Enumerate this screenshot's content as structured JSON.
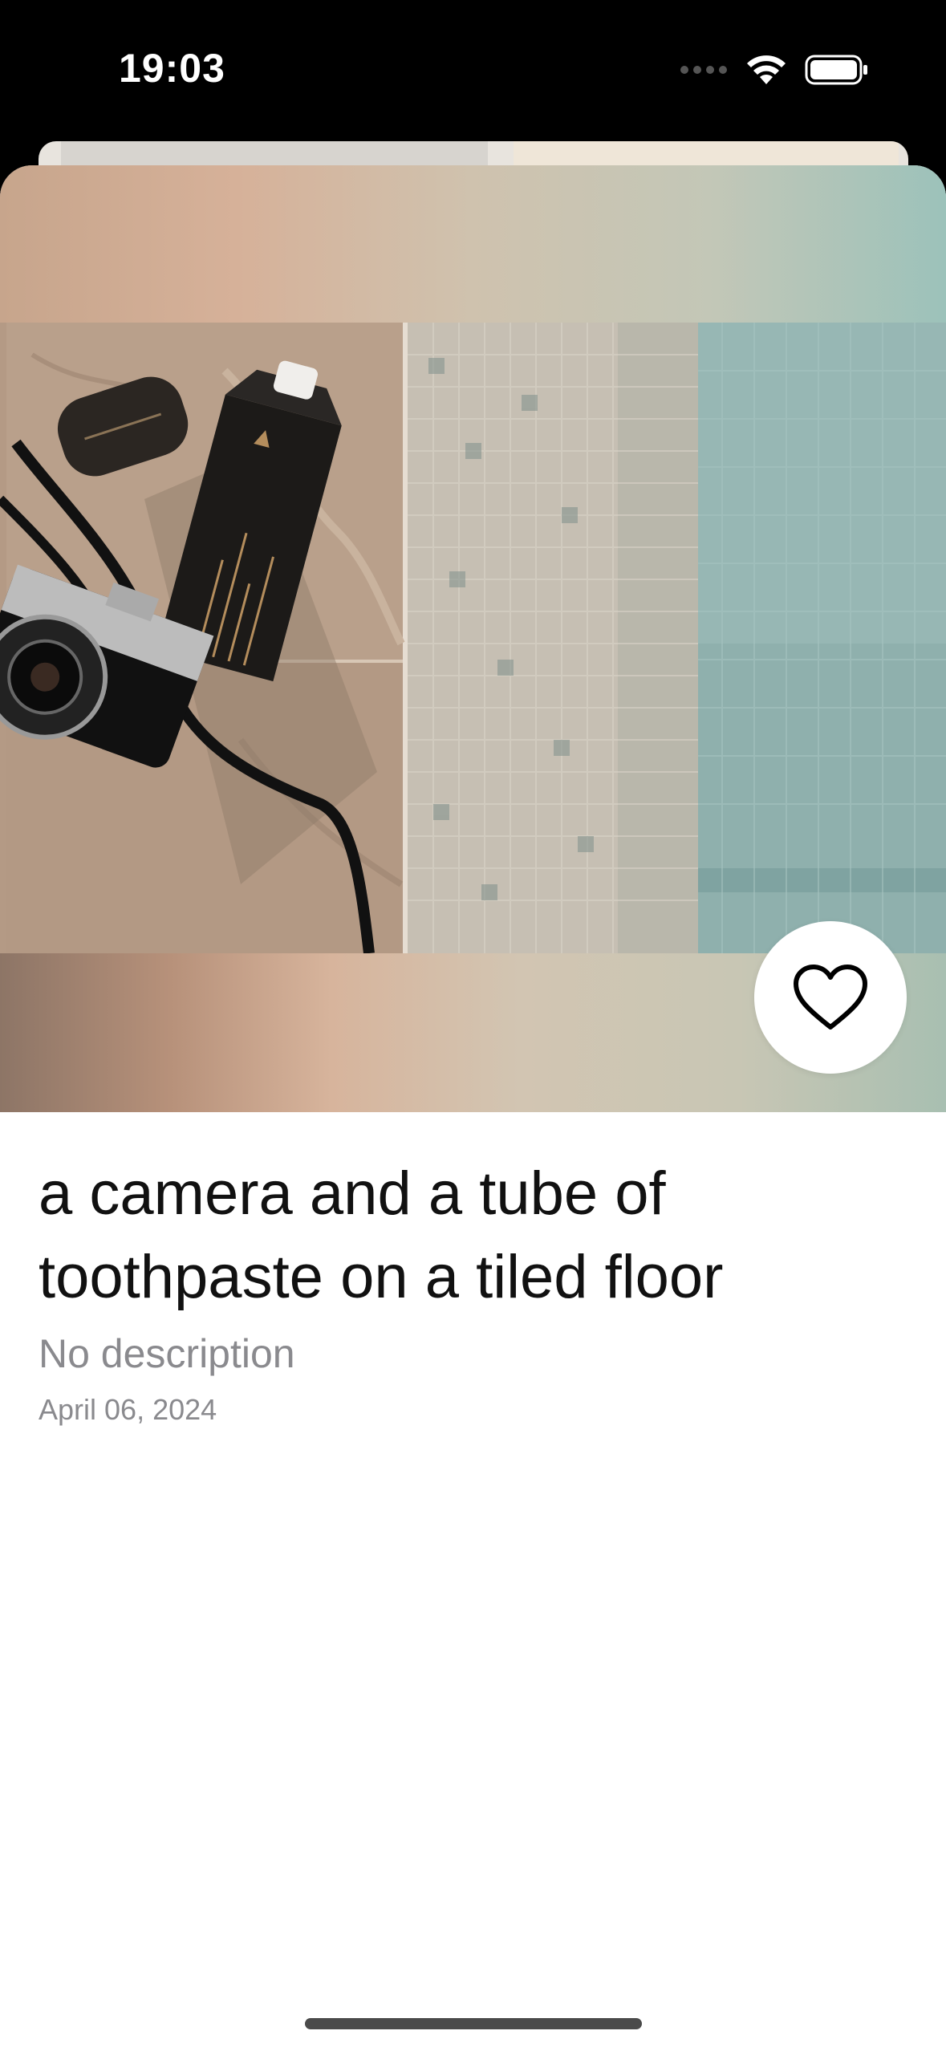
{
  "status_bar": {
    "time": "19:03",
    "icons": [
      "signal-dots-icon",
      "wifi-icon",
      "battery-icon"
    ]
  },
  "photo": {
    "alt": "a camera and a tube of toothpaste on a tiled floor",
    "icons": [
      "photo-image"
    ]
  },
  "actions": {
    "favorite_icon": "heart-icon"
  },
  "details": {
    "title": "a camera and a tube of toothpaste on a tiled floor",
    "description": "No description",
    "date": "April 06, 2024"
  },
  "colors": {
    "background": "#000000",
    "sheet": "#ffffff",
    "title_text": "#111111",
    "secondary_text": "#8a8a8e"
  }
}
